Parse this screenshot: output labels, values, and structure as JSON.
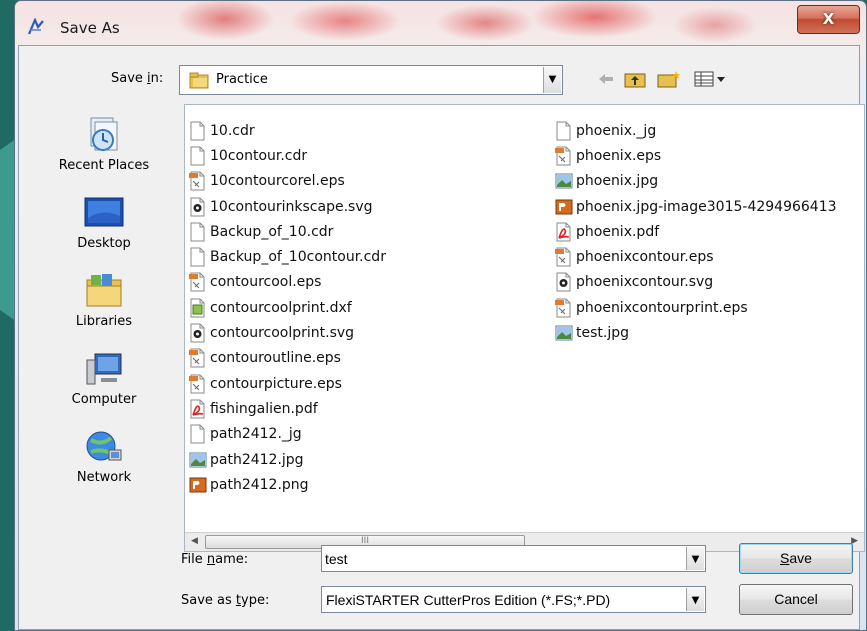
{
  "window": {
    "title": "Save As",
    "close_label": "X"
  },
  "save_in": {
    "label_before": "Save ",
    "label_mnemonic": "i",
    "label_after": "n:",
    "value": "Practice"
  },
  "places": [
    {
      "label": "Recent Places",
      "icon": "recent-places-icon"
    },
    {
      "label": "Desktop",
      "icon": "desktop-icon"
    },
    {
      "label": "Libraries",
      "icon": "libraries-icon"
    },
    {
      "label": "Computer",
      "icon": "computer-icon"
    },
    {
      "label": "Network",
      "icon": "network-icon"
    }
  ],
  "files_col1": [
    {
      "name": "10.cdr",
      "type": "blank"
    },
    {
      "name": "10contour.cdr",
      "type": "blank"
    },
    {
      "name": "10contourcorel.eps",
      "type": "eps"
    },
    {
      "name": "10contourinkscape.svg",
      "type": "svg"
    },
    {
      "name": "Backup_of_10.cdr",
      "type": "blank"
    },
    {
      "name": "Backup_of_10contour.cdr",
      "type": "blank"
    },
    {
      "name": "contourcool.eps",
      "type": "eps"
    },
    {
      "name": "contourcoolprint.dxf",
      "type": "dxf"
    },
    {
      "name": "contourcoolprint.svg",
      "type": "svg"
    },
    {
      "name": "contouroutline.eps",
      "type": "eps"
    },
    {
      "name": "contourpicture.eps",
      "type": "eps"
    },
    {
      "name": "fishingalien.pdf",
      "type": "pdf"
    },
    {
      "name": "path2412._jg",
      "type": "blank"
    },
    {
      "name": "path2412.jpg",
      "type": "jpg"
    },
    {
      "name": "path2412.png",
      "type": "png"
    }
  ],
  "files_col2": [
    {
      "name": "phoenix._jg",
      "type": "blank"
    },
    {
      "name": "phoenix.eps",
      "type": "eps"
    },
    {
      "name": "phoenix.jpg",
      "type": "jpg"
    },
    {
      "name": "phoenix.jpg-image3015-4294966413",
      "type": "png"
    },
    {
      "name": "phoenix.pdf",
      "type": "pdf"
    },
    {
      "name": "phoenixcontour.eps",
      "type": "eps"
    },
    {
      "name": "phoenixcontour.svg",
      "type": "svg"
    },
    {
      "name": "phoenixcontourprint.eps",
      "type": "eps"
    },
    {
      "name": "test.jpg",
      "type": "jpg"
    }
  ],
  "file_name": {
    "label_before": "File ",
    "label_mnemonic": "n",
    "label_after": "ame:",
    "value": "test"
  },
  "save_as_type": {
    "label_before": "Save as ",
    "label_mnemonic": "t",
    "label_after": "ype:",
    "value": "FlexiSTARTER CutterPros Edition (*.FS;*.PD)"
  },
  "buttons": {
    "save_mnemonic": "S",
    "save_rest": "ave",
    "cancel": "Cancel"
  },
  "scrollbar_grip": "III",
  "colors": {
    "desktop_bg": "#1f6b63",
    "close_button": "#c24a30",
    "list_bg": "#ffffff"
  }
}
